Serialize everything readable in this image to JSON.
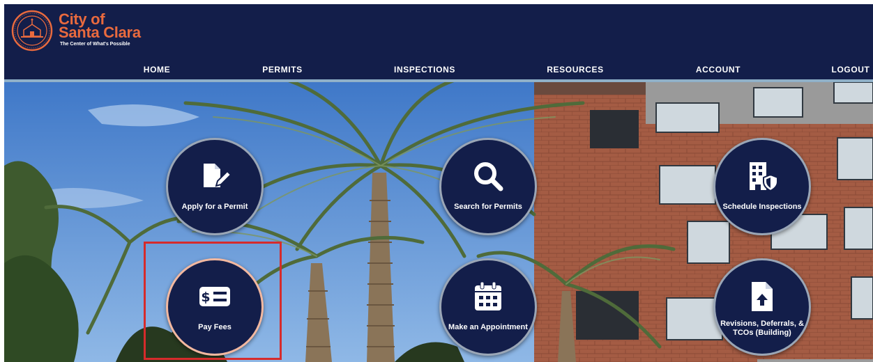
{
  "logo": {
    "line1": "City of",
    "line2": "Santa Clara",
    "tagline": "The Center of What's Possible"
  },
  "nav": {
    "items": [
      {
        "label": "HOME"
      },
      {
        "label": "PERMITS"
      },
      {
        "label": "INSPECTIONS"
      },
      {
        "label": "RESOURCES"
      },
      {
        "label": "ACCOUNT"
      },
      {
        "label": "LOGOUT"
      }
    ]
  },
  "tiles": [
    {
      "label": "Apply for a Permit",
      "icon": "file-pen-icon"
    },
    {
      "label": "Search for Permits",
      "icon": "search-icon"
    },
    {
      "label": "Schedule Inspections",
      "icon": "building-shield-icon"
    },
    {
      "label": "Pay Fees",
      "icon": "money-bill-icon"
    },
    {
      "label": "Make an Appointment",
      "icon": "calendar-icon"
    },
    {
      "label": "Revisions, Deferrals, & TCOs (Building)",
      "icon": "file-upload-icon"
    }
  ],
  "colors": {
    "header_bg": "#131e4a",
    "logo_accent": "#e96a3e",
    "tile_bg": "#131e4a",
    "selection_outline": "#d62b2b"
  }
}
